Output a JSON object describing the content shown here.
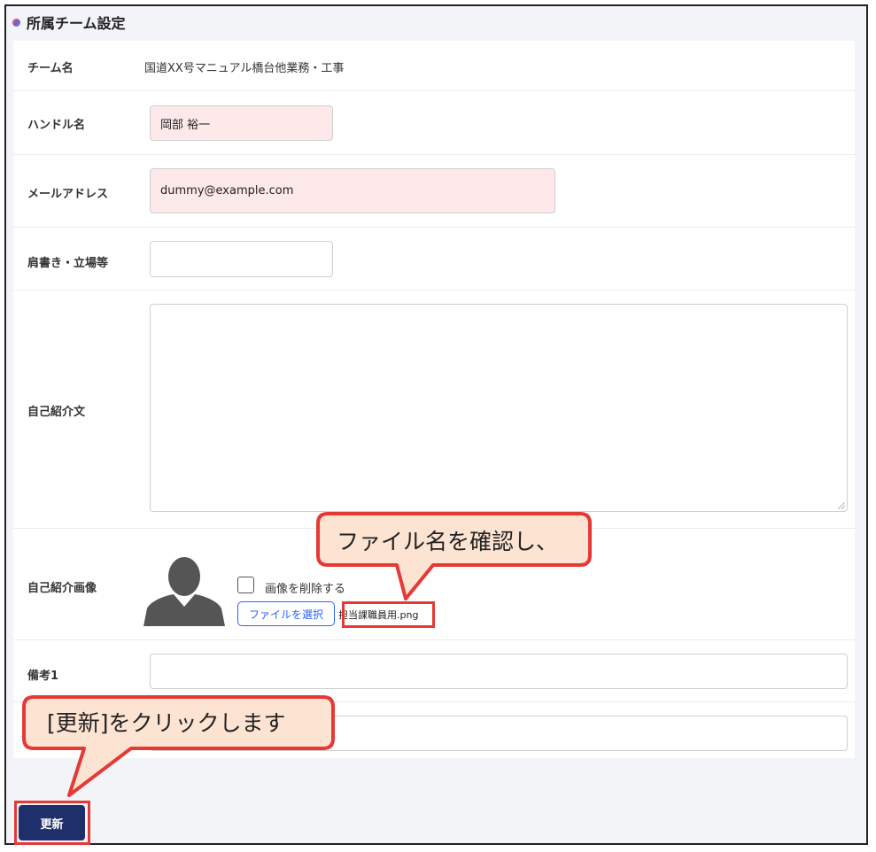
{
  "section": {
    "title": "所属チーム設定"
  },
  "form": {
    "team_label": "チーム名",
    "team_value": "国道XX号マニュアル橋台他業務・工事",
    "handle_label": "ハンドル名",
    "handle_value": "岡部 裕一",
    "email_label": "メールアドレス",
    "email_value": "dummy@example.com",
    "position_label": "肩書き・立場等",
    "position_value": "",
    "intro_label": "自己紹介文",
    "intro_value": "",
    "image_label": "自己紹介画像",
    "delete_image_label": "画像を削除する",
    "choose_file_label": "ファイルを選択",
    "file_name": "担当課職員用.png",
    "note1_label": "備考1",
    "note1_value": "",
    "note2_value": ""
  },
  "actions": {
    "update_label": "更新"
  },
  "callouts": {
    "file_check": "ファイル名を確認し、",
    "click_update": "[更新]をクリックします"
  },
  "colors": {
    "primary_button": "#1f2f6b",
    "required_field_bg": "#fde8ea",
    "link_blue": "#2962ff",
    "highlight_red": "#e53935",
    "callout_fill": "#fde3d2"
  }
}
